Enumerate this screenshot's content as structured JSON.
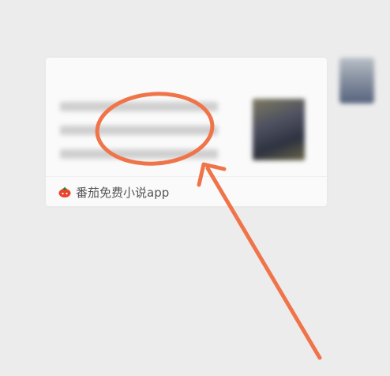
{
  "timestamp": "",
  "card": {
    "title": "",
    "source_app": "番茄免费小说app",
    "source_icon": "tomato-icon"
  },
  "annotation": {
    "color": "#f0744a",
    "shapes": [
      "circle",
      "arrow"
    ]
  },
  "colors": {
    "background": "#ececec",
    "card": "#fafafa",
    "annotation": "#f0744a"
  }
}
